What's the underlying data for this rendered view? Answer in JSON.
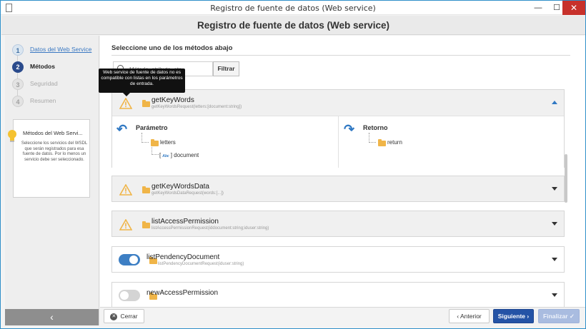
{
  "window": {
    "title": "Registro de fuente de datos (Web service)",
    "minimize": "—",
    "maximize": "☐",
    "close": "✕"
  },
  "header": {
    "title": "Registro de fuente de datos (Web service)"
  },
  "steps": [
    {
      "num": "1",
      "label": "Datos del Web Service",
      "state": "done"
    },
    {
      "num": "2",
      "label": "Métodos",
      "state": "active"
    },
    {
      "num": "3",
      "label": "Seguridad",
      "state": "todo"
    },
    {
      "num": "4",
      "label": "Resumen",
      "state": "todo"
    }
  ],
  "info": {
    "title": "Métodos del Web Servi...",
    "body": "Seleccione los servicios del WSDL que serán registrados para esa fuente de datos. Por lo menos un servicio debe ser seleccionado."
  },
  "sidebar": {
    "collapse": "‹"
  },
  "main": {
    "title": "Seleccione uno de los métodos abajo"
  },
  "search": {
    "placeholder": "Método, atributo, etc.",
    "filter_label": "Filtrar"
  },
  "tooltip": "Web service de fuente de datos no es compatible con listas en los parámetros de entrada.",
  "methods": [
    {
      "name": "getKeyWords",
      "signature": "getKeyWordsRequest(letters:[document:string])",
      "status": "warning",
      "expanded": true
    },
    {
      "name": "getKeyWordsData",
      "signature": "getKeyWordsDataRequest(words:[...])",
      "status": "warning",
      "expanded": false
    },
    {
      "name": "listAccessPermission",
      "signature": "listAccessPermissionRequest(iddocument:string;iduser:string)",
      "status": "warning",
      "expanded": false
    },
    {
      "name": "listPendencyDocument",
      "signature": "listPendencyDocumentRequest(iduser:string)",
      "status": "on",
      "expanded": false
    },
    {
      "name": "newAccessPermission",
      "signature": "",
      "status": "off",
      "expanded": false
    }
  ],
  "detail": {
    "param_title": "Parámetro",
    "return_title": "Retorno",
    "param_folder": "letters",
    "param_item_prefix": "[",
    "param_item_type": "Abc",
    "param_item": "] document",
    "return_item": "return"
  },
  "footer": {
    "close": "Cerrar",
    "prev": "Anterior",
    "next": "Siguiente",
    "finish": "Finalizar"
  },
  "colors": {
    "accent": "#2453a6",
    "warning": "#f0b548",
    "toggle_on": "#3d7fc4"
  }
}
